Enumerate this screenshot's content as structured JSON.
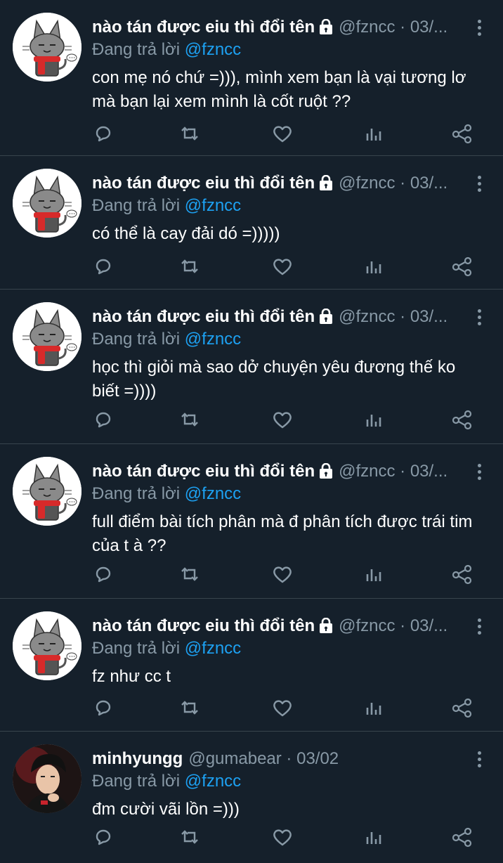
{
  "tweets": [
    {
      "name": "nào tán được eiu thì đổi tên",
      "handle": "@fzncc · 03/...",
      "reply_prefix": "Đang trả lời",
      "reply_to": "@fzncc",
      "text": "con mẹ nó chứ =))), mình xem bạn là vại tương lơ mà bạn lại xem mình là cốt ruột ??",
      "avatar": "cat-avatar",
      "locked": true
    },
    {
      "name": "nào tán được eiu thì đổi tên",
      "handle": "@fzncc · 03/...",
      "reply_prefix": "Đang trả lời",
      "reply_to": "@fzncc",
      "text": "có thể là cay đải dó =)))))",
      "avatar": "cat-avatar",
      "locked": true
    },
    {
      "name": "nào tán được eiu thì đổi tên",
      "handle": "@fzncc · 03/...",
      "reply_prefix": "Đang trả lời",
      "reply_to": "@fzncc",
      "text": "học thì giỏi mà sao dở chuyện yêu đương thế ko biết =))))",
      "avatar": "cat-avatar",
      "locked": true
    },
    {
      "name": "nào tán được eiu thì đổi tên",
      "handle": "@fzncc · 03/...",
      "reply_prefix": "Đang trả lời",
      "reply_to": "@fzncc",
      "text": "full điểm bài tích phân mà đ phân tích được trái tim của t à ??",
      "avatar": "cat-avatar",
      "locked": true
    },
    {
      "name": "nào tán được eiu thì đổi tên",
      "handle": "@fzncc · 03/...",
      "reply_prefix": "Đang trả lời",
      "reply_to": "@fzncc",
      "text": "fz như cc t",
      "avatar": "cat-avatar",
      "locked": true
    },
    {
      "name": "minhyungg",
      "handle": "@gumabear · 03/02",
      "reply_prefix": "Đang trả lời",
      "reply_to": "@fzncc",
      "text": "đm cười vãi lồn =)))",
      "avatar": "person-avatar",
      "locked": false
    }
  ],
  "icons": {
    "reply": "reply-icon",
    "retweet": "retweet-icon",
    "like": "heart-icon",
    "stats": "analytics-icon",
    "share": "share-icon",
    "more": "more-vertical-icon",
    "lock": "lock-icon"
  },
  "colors": {
    "background": "#15202b",
    "divider": "#38444d",
    "secondary_text": "#8899a6",
    "link": "#1da1f2",
    "text": "#ffffff"
  }
}
